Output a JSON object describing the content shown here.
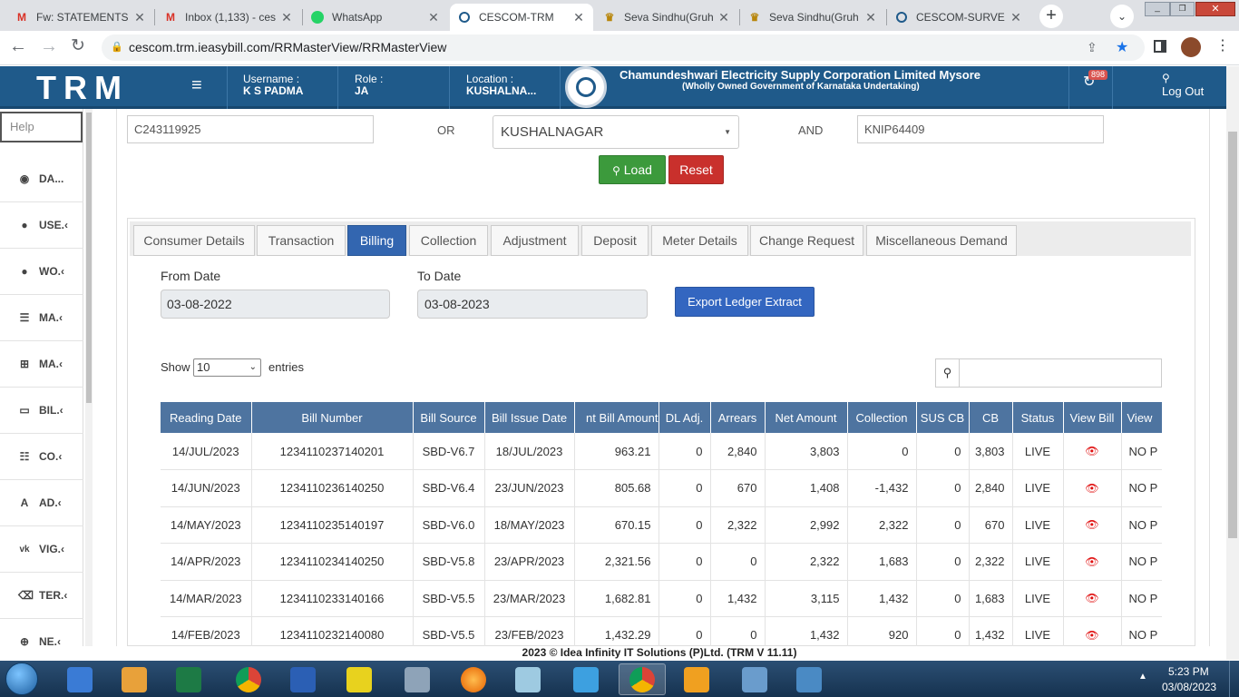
{
  "browser": {
    "tabs": [
      {
        "title": "Fw: STATEMENTS",
        "icon": "gmail-icon"
      },
      {
        "title": "Inbox (1,133) - ces",
        "icon": "gmail-icon"
      },
      {
        "title": "WhatsApp",
        "icon": "whatsapp-icon"
      },
      {
        "title": "CESCOM-TRM",
        "icon": "cescom-icon"
      },
      {
        "title": "Seva Sindhu(Gruh",
        "icon": "karnataka-emblem-icon"
      },
      {
        "title": "Seva Sindhu(Gruh",
        "icon": "karnataka-emblem-icon"
      },
      {
        "title": "CESCOM-SURVEY",
        "icon": "cescom-icon"
      }
    ],
    "url": "cescom.trm.ieasybill.com/RRMasterView/RRMasterView"
  },
  "header": {
    "brand": "TRM",
    "username_label": "Username :",
    "username": "K S PADMA",
    "role_label": "Role :",
    "role": "JA",
    "location_label": "Location :",
    "location": "KUSHALNA...",
    "org_name": "Chamundeshwari Electricity Supply Corporation Limited Mysore",
    "org_sub": "(Wholly Owned Government of Karnataka Undertaking)",
    "notification_count": "898",
    "logout": "Log Out"
  },
  "sidebar": {
    "help_placeholder": "Help",
    "items": [
      {
        "label": "DA...",
        "icon": "dashboard-icon"
      },
      {
        "label": "USE.‹",
        "icon": "user-icon"
      },
      {
        "label": "WO.‹",
        "icon": "user-icon"
      },
      {
        "label": "MA.‹",
        "icon": "list-icon"
      },
      {
        "label": "MA.‹",
        "icon": "sitemap-icon"
      },
      {
        "label": "BIL.‹",
        "icon": "monitor-icon"
      },
      {
        "label": "CO.‹",
        "icon": "checklist-icon"
      },
      {
        "label": "AD.‹",
        "icon": "font-icon"
      },
      {
        "label": "VIG.‹",
        "icon": "vk-icon"
      },
      {
        "label": "TER.‹",
        "icon": "trash-icon"
      },
      {
        "label": "NE.‹",
        "icon": "plus-circle-icon"
      }
    ]
  },
  "search": {
    "account_id": "C243119925",
    "or_label": "OR",
    "location_select": "KUSHALNAGAR",
    "and_label": "AND",
    "rr_number": "KNIP64409",
    "load_button": "Load",
    "reset_button": "Reset"
  },
  "tabs": [
    {
      "label": "Consumer Details",
      "active": false
    },
    {
      "label": "Transaction",
      "active": false
    },
    {
      "label": "Billing",
      "active": true
    },
    {
      "label": "Collection",
      "active": false
    },
    {
      "label": "Adjustment",
      "active": false
    },
    {
      "label": "Deposit",
      "active": false
    },
    {
      "label": "Meter Details",
      "active": false
    },
    {
      "label": "Change Request",
      "active": false
    },
    {
      "label": "Miscellaneous Demand",
      "active": false
    }
  ],
  "billing": {
    "from_label": "From Date",
    "from_date": "03-08-2022",
    "to_label": "To Date",
    "to_date": "03-08-2023",
    "export_button": "Export Ledger Extract",
    "show_label": "Show",
    "entries_value": "10",
    "entries_label": "entries",
    "columns": [
      "Reading Date",
      "Bill Number",
      "Bill Source",
      "Bill Issue Date",
      "nt Bill Amount",
      "DL Adj.",
      "Arrears",
      "Net Amount",
      "Collection",
      "SUS CB",
      "CB",
      "Status",
      "View Bill",
      "View"
    ],
    "rows": [
      [
        "14/JUL/2023",
        "1234110237140201",
        "SBD-V6.7",
        "18/JUL/2023",
        "963.21",
        "0",
        "2,840",
        "3,803",
        "0",
        "0",
        "3,803",
        "LIVE",
        "NO P"
      ],
      [
        "14/JUN/2023",
        "1234110236140250",
        "SBD-V6.4",
        "23/JUN/2023",
        "805.68",
        "0",
        "670",
        "1,408",
        "-1,432",
        "0",
        "2,840",
        "LIVE",
        "NO P"
      ],
      [
        "14/MAY/2023",
        "1234110235140197",
        "SBD-V6.0",
        "18/MAY/2023",
        "670.15",
        "0",
        "2,322",
        "2,992",
        "2,322",
        "0",
        "670",
        "LIVE",
        "NO P"
      ],
      [
        "14/APR/2023",
        "1234110234140250",
        "SBD-V5.8",
        "23/APR/2023",
        "2,321.56",
        "0",
        "0",
        "2,322",
        "1,683",
        "0",
        "2,322",
        "LIVE",
        "NO P"
      ],
      [
        "14/MAR/2023",
        "1234110233140166",
        "SBD-V5.5",
        "23/MAR/2023",
        "1,682.81",
        "0",
        "1,432",
        "3,115",
        "1,432",
        "0",
        "1,683",
        "LIVE",
        "NO P"
      ],
      [
        "14/FEB/2023",
        "1234110232140080",
        "SBD-V5.5",
        "23/FEB/2023",
        "1,432.29",
        "0",
        "0",
        "1,432",
        "920",
        "0",
        "1,432",
        "LIVE",
        "NO P"
      ]
    ]
  },
  "footer": "2023 © Idea Infinity IT Solutions (P)Ltd. (TRM V 11.11)",
  "taskbar": {
    "time": "5:23 PM",
    "date": "03/08/2023"
  },
  "colors": {
    "header_bg": "#1f5a8a",
    "load_btn": "#3c9a3c",
    "reset_btn": "#c9302c",
    "export_btn": "#3366c0",
    "table_header": "#4e74a0",
    "active_tab": "#3366b0"
  }
}
